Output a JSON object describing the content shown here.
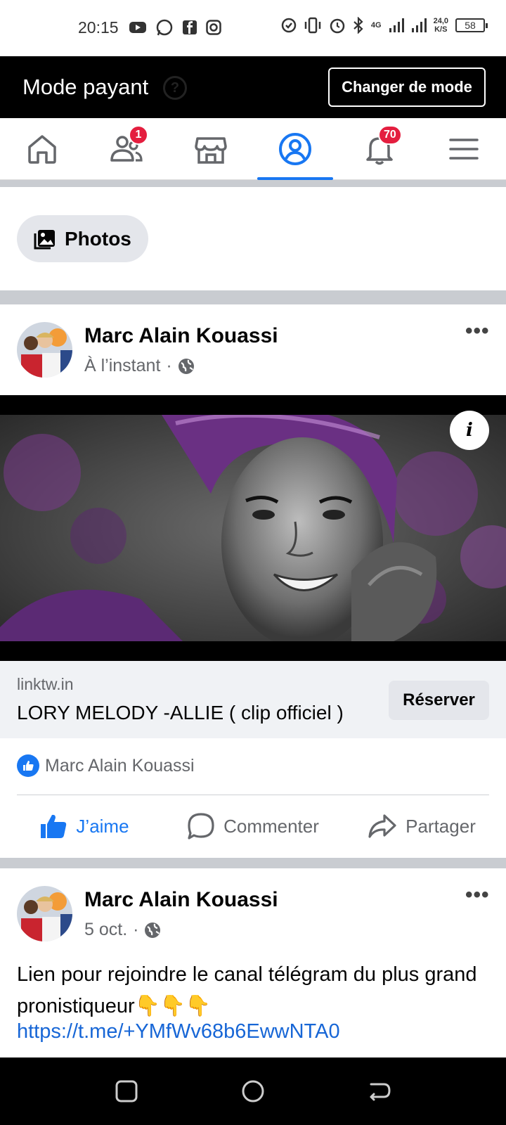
{
  "status_bar": {
    "time": "20:15",
    "network": "4G",
    "speed_value": "24,0",
    "speed_unit": "K/S",
    "battery": "58"
  },
  "mode_bar": {
    "title": "Mode payant",
    "button_label": "Changer de mode"
  },
  "tabs": [
    {
      "name": "home",
      "icon": "home-icon"
    },
    {
      "name": "friends",
      "icon": "friends-icon",
      "badge": "1"
    },
    {
      "name": "marketplace",
      "icon": "marketplace-icon"
    },
    {
      "name": "profile",
      "icon": "profile-icon",
      "active": true
    },
    {
      "name": "notifications",
      "icon": "bell-icon",
      "badge": "70"
    },
    {
      "name": "menu",
      "icon": "hamburger-icon"
    }
  ],
  "photos_chip": {
    "label": "Photos"
  },
  "posts": [
    {
      "author": "Marc Alain Kouassi",
      "time": "À l’instant",
      "separator": "·",
      "link": {
        "domain": "linktw.in",
        "title": "LORY MELODY -ALLIE ( clip officiel )",
        "button": "Réserver"
      },
      "reactions": {
        "names": "Marc Alain Kouassi"
      },
      "actions": {
        "like": "J’aime",
        "comment": "Commenter",
        "share": "Partager"
      }
    },
    {
      "author": "Marc Alain Kouassi",
      "time": "5 oct.",
      "separator": "·",
      "text": "Lien pour rejoindre le canal télégram du plus grand pronistiqueur👇👇👇",
      "url": "https://t.me/+YMfWv68b6EwwNTA0"
    }
  ],
  "colors": {
    "accent": "#1877f2",
    "badge": "#e41e3f",
    "mode_bar_bg": "#000000",
    "divider": "#c9ccd1"
  }
}
